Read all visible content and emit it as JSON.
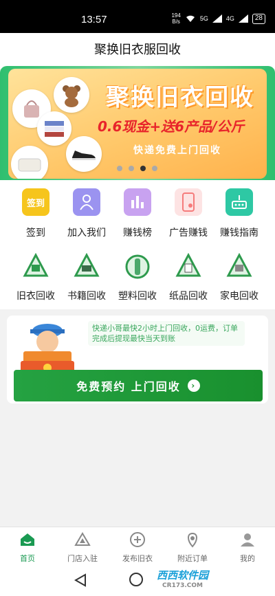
{
  "status_bar": {
    "time": "13:57",
    "net_speed_value": "194",
    "net_speed_unit": "B/s",
    "signal_1": "5G",
    "signal_2": "4G",
    "battery": "28"
  },
  "header": {
    "title": "聚换旧衣服回收"
  },
  "banner": {
    "title": "聚换旧衣回收",
    "promo": "0.6现金+送6产品/公斤",
    "subtitle": "快递免费上门回收",
    "slides_total": 4,
    "active_slide": 3
  },
  "quick_actions": [
    {
      "label": "签到",
      "icon": "signin-calendar-icon",
      "icon_text": "签到",
      "color": "#f6c51c"
    },
    {
      "label": "加入我们",
      "icon": "team-icon",
      "color": "#9b93f0"
    },
    {
      "label": "赚钱榜",
      "icon": "ranking-bars-icon",
      "color": "#c8a2f0"
    },
    {
      "label": "广告赚钱",
      "icon": "phone-ad-icon",
      "color": "#f57b7b"
    },
    {
      "label": "赚钱指南",
      "icon": "guide-icon",
      "color": "#2ec8a4"
    }
  ],
  "recycle_categories": [
    {
      "label": "旧衣回收",
      "icon": "clothes-recycle-icon"
    },
    {
      "label": "书籍回收",
      "icon": "book-recycle-icon"
    },
    {
      "label": "塑料回收",
      "icon": "plastic-recycle-icon"
    },
    {
      "label": "纸品回收",
      "icon": "paper-recycle-icon"
    },
    {
      "label": "家电回收",
      "icon": "appliance-recycle-icon"
    }
  ],
  "pickup": {
    "notice": "快递小哥最快2小时上门回收，0运费，订单完成后提现最快当天到账",
    "cta_label": "免费预约 上门回收"
  },
  "tab_bar": [
    {
      "label": "首页",
      "icon": "home-icon",
      "active": true
    },
    {
      "label": "门店入驻",
      "icon": "store-icon",
      "active": false
    },
    {
      "label": "发布旧衣",
      "icon": "add-circle-icon",
      "active": false
    },
    {
      "label": "附近订单",
      "icon": "location-pin-icon",
      "active": false
    },
    {
      "label": "我的",
      "icon": "profile-icon",
      "active": false
    }
  ],
  "watermark": {
    "brand": "西西软件园",
    "domain": "CR173.COM"
  },
  "colors": {
    "brand_green": "#1a9a52",
    "cta_green": "#19902e",
    "promo_red": "#e8242b",
    "banner_orange": "#ffb24c"
  }
}
